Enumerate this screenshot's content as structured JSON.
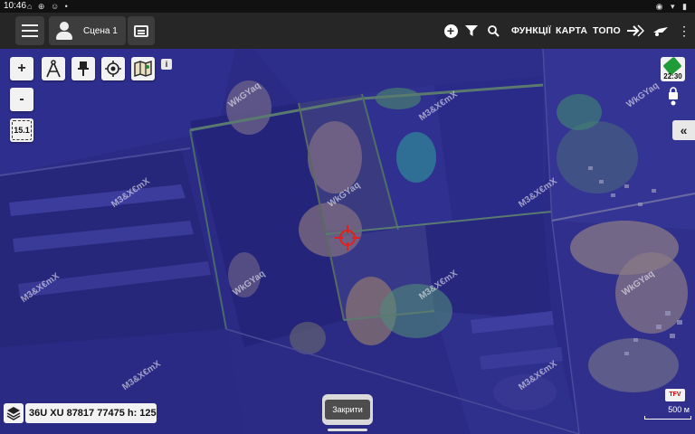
{
  "status_bar": {
    "time": "10:46"
  },
  "toolbar": {
    "scene_label": "Сцена 1",
    "functions_label": "ФУНКЦІЇ",
    "map_label": "КАРТА",
    "topo_label": "ТОПО"
  },
  "map": {
    "zoom_level": "15.1",
    "gps_time": "22:30",
    "coordinates": "36U XU 87817 77475 h: 125",
    "close_label": "Закрити",
    "scale_label": "500 м",
    "tfv_label": "TFV",
    "info_label": "i",
    "collapse_label": "«",
    "watermarks": [
      "WkGYaq",
      "M3&X€mX"
    ]
  },
  "colors": {
    "map_base": "#2b2b86",
    "toolbar": "#262626",
    "crosshair": "#e02020",
    "gps_green": "#1f9b38"
  }
}
